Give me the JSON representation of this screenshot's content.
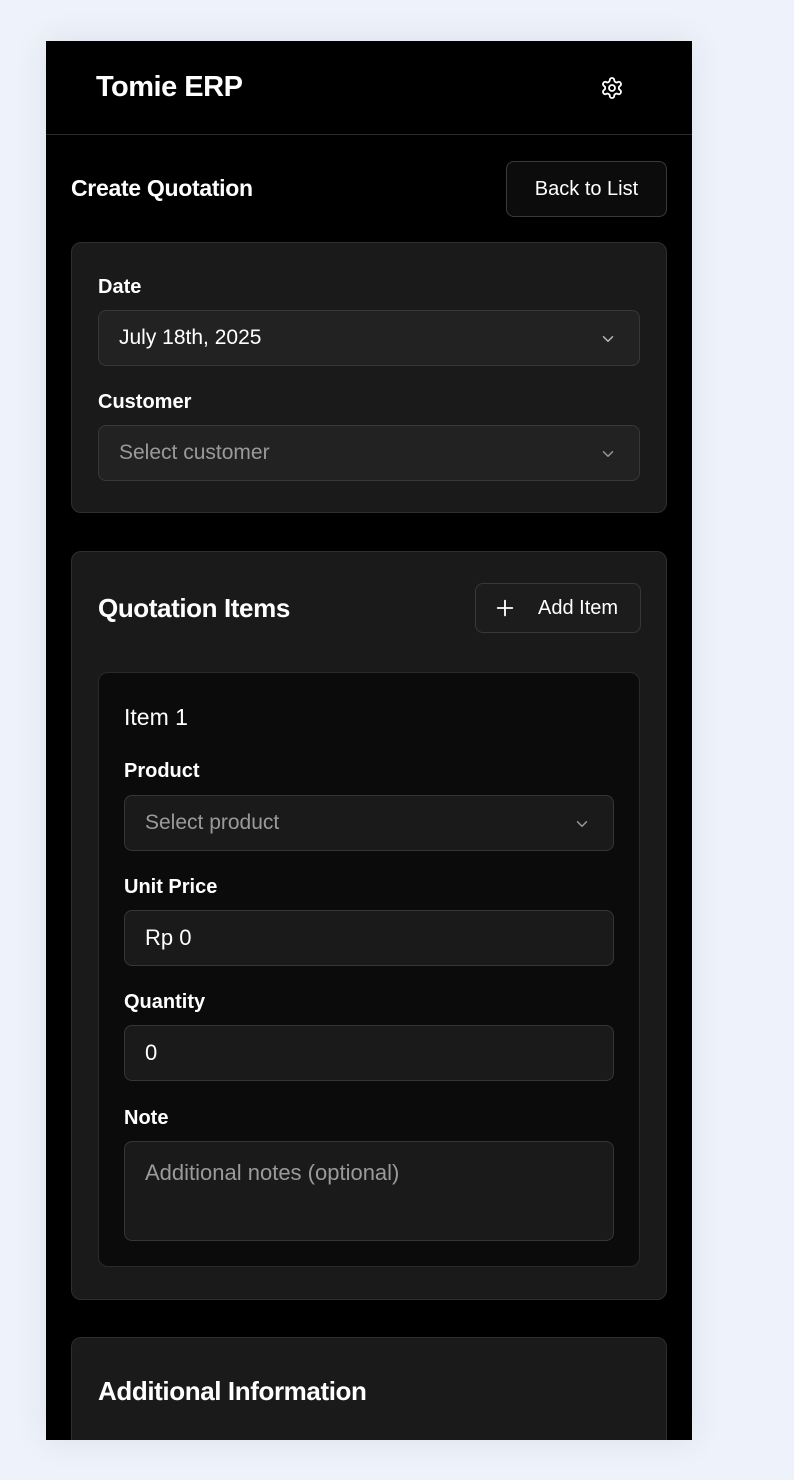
{
  "app": {
    "title": "Tomie ERP"
  },
  "page": {
    "title": "Create Quotation",
    "back_label": "Back to List"
  },
  "general": {
    "date_label": "Date",
    "date_value": "July 18th, 2025",
    "customer_label": "Customer",
    "customer_placeholder": "Select customer"
  },
  "items_section": {
    "title": "Quotation Items",
    "add_label": "Add Item",
    "items": [
      {
        "title": "Item 1",
        "product_label": "Product",
        "product_placeholder": "Select product",
        "unit_price_label": "Unit Price",
        "unit_price_value": "Rp 0",
        "quantity_label": "Quantity",
        "quantity_value": "0",
        "note_label": "Note",
        "note_placeholder": "Additional notes (optional)"
      }
    ]
  },
  "additional": {
    "title": "Additional Information"
  },
  "icons": {
    "settings": "gear-icon",
    "dropdown": "chevron-down-icon",
    "add": "plus-icon"
  },
  "colors": {
    "page_background": "#eef2fa",
    "app_background": "#000000",
    "card_background": "#1a1a1a",
    "input_background": "#222222",
    "placeholder_text": "#9a9a9a"
  }
}
